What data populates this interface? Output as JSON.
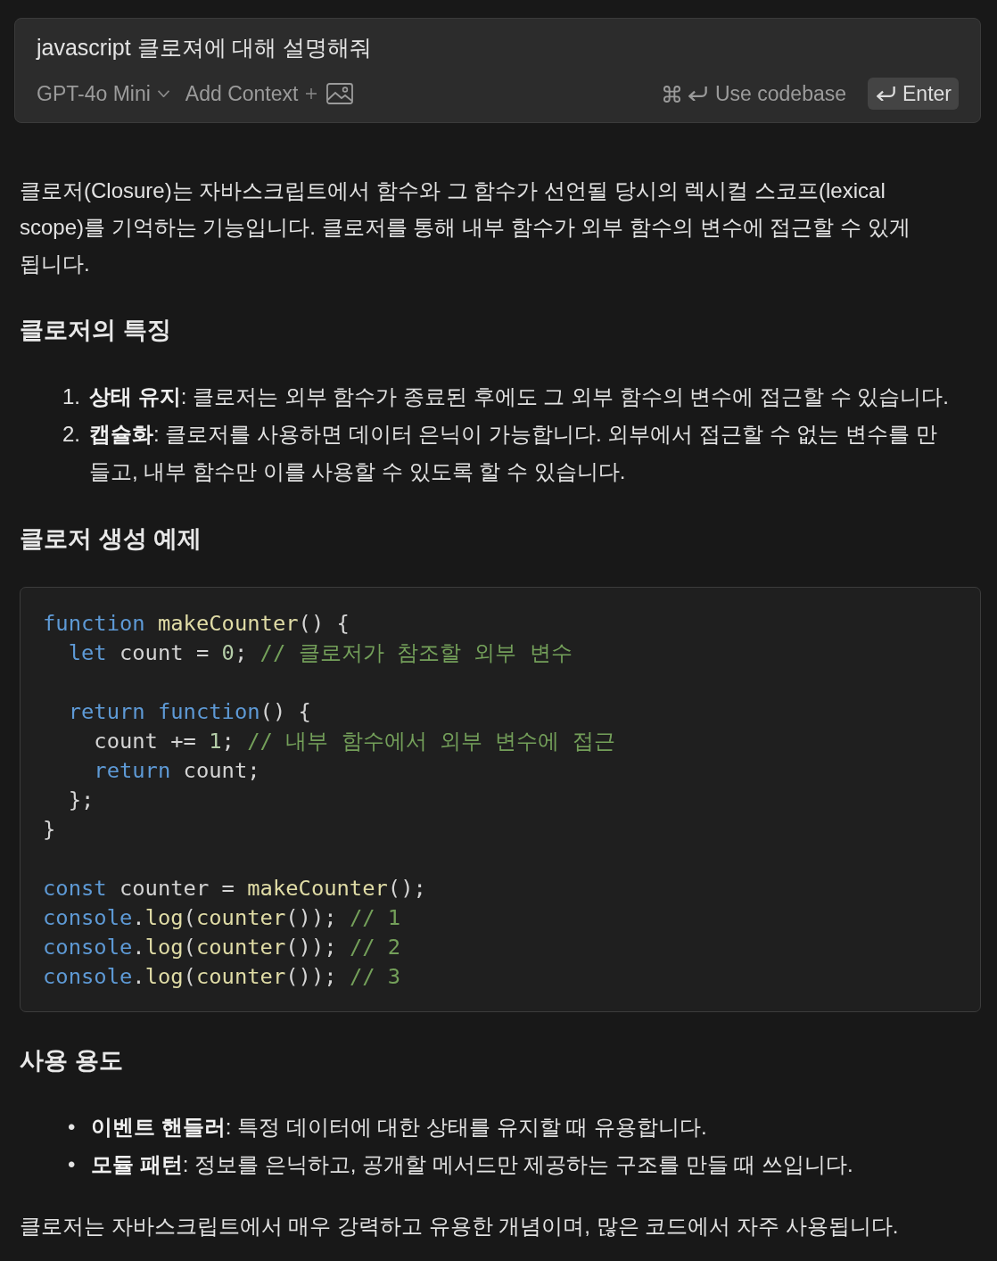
{
  "prompt": {
    "query": "javascript 클로져에 대해 설명해줘",
    "model": "GPT-4o Mini",
    "add_context": "Add Context",
    "use_codebase": "Use codebase",
    "enter": "Enter"
  },
  "answer": [
    {
      "kind": "paragraph",
      "text": "클로저(Closure)는 자바스크립트에서 함수와 그 함수가 선언될 당시의 렉시컬 스코프(lexical scope)를 기억하는 기능입니다. 클로저를 통해 내부 함수가 외부 함수의 변수에 접근할 수 있게 됩니다."
    },
    {
      "kind": "heading",
      "text": "클로저의 특징"
    },
    {
      "kind": "ordered_list",
      "items": [
        {
          "marker": "1.",
          "text": "**상태 유지**: 클로저는 외부 함수가 종료된 후에도 그 외부 함수의 변수에 접근할 수 있습니다."
        },
        {
          "marker": "2.",
          "text": "**캡슐화**: 클로저를 사용하면 데이터 은닉이 가능합니다. 외부에서 접근할 수 없는 변수를 만들고, 내부 함수만 이를 사용할 수 있도록 할 수 있습니다."
        }
      ]
    },
    {
      "kind": "heading",
      "text": "클로저 생성 예제"
    },
    {
      "kind": "code",
      "groups": [
        [
          [
            {
              "kind": "keyword",
              "text": "function "
            },
            {
              "kind": "function",
              "text": "makeCounter"
            },
            {
              "kind": "plain",
              "text": "() {"
            }
          ],
          [
            {
              "kind": "keyword",
              "text": "  let"
            },
            {
              "kind": "plain",
              "text": " count = "
            },
            {
              "kind": "number",
              "text": "0"
            },
            {
              "kind": "plain",
              "text": "; "
            },
            {
              "kind": "comment",
              "text": "// 클로저가 참조할 외부 변수"
            }
          ]
        ],
        [
          [
            {
              "kind": "keyword",
              "text": "  return function"
            },
            {
              "kind": "plain",
              "text": "() {"
            }
          ],
          [
            {
              "kind": "plain",
              "text": "    count += "
            },
            {
              "kind": "number",
              "text": "1"
            },
            {
              "kind": "plain",
              "text": "; "
            },
            {
              "kind": "comment",
              "text": "// 내부 함수에서 외부 변수에 접근"
            }
          ],
          [
            {
              "kind": "keyword",
              "text": "    return"
            },
            {
              "kind": "plain",
              "text": " count;"
            }
          ],
          [
            {
              "kind": "plain",
              "text": "  };"
            }
          ],
          [
            {
              "kind": "plain",
              "text": "}"
            }
          ]
        ],
        [
          [
            {
              "kind": "keyword",
              "text": "const"
            },
            {
              "kind": "plain",
              "text": " counter = "
            },
            {
              "kind": "function",
              "text": "makeCounter"
            },
            {
              "kind": "plain",
              "text": "();"
            }
          ],
          [
            {
              "kind": "keyword",
              "text": "console"
            },
            {
              "kind": "plain",
              "text": "."
            },
            {
              "kind": "function",
              "text": "log"
            },
            {
              "kind": "plain",
              "text": "("
            },
            {
              "kind": "function",
              "text": "counter"
            },
            {
              "kind": "plain",
              "text": "()); "
            },
            {
              "kind": "comment",
              "text": "// 1"
            }
          ],
          [
            {
              "kind": "keyword",
              "text": "console"
            },
            {
              "kind": "plain",
              "text": "."
            },
            {
              "kind": "function",
              "text": "log"
            },
            {
              "kind": "plain",
              "text": "("
            },
            {
              "kind": "function",
              "text": "counter"
            },
            {
              "kind": "plain",
              "text": "()); "
            },
            {
              "kind": "comment",
              "text": "// 2"
            }
          ],
          [
            {
              "kind": "keyword",
              "text": "console"
            },
            {
              "kind": "plain",
              "text": "."
            },
            {
              "kind": "function",
              "text": "log"
            },
            {
              "kind": "plain",
              "text": "("
            },
            {
              "kind": "function",
              "text": "counter"
            },
            {
              "kind": "plain",
              "text": "()); "
            },
            {
              "kind": "comment",
              "text": "// 3"
            }
          ]
        ]
      ]
    },
    {
      "kind": "heading",
      "text": "사용 용도"
    },
    {
      "kind": "bullet_list",
      "items": [
        {
          "marker": "•",
          "text": "**이벤트 핸들러**: 특정 데이터에 대한 상태를 유지할 때 유용합니다."
        },
        {
          "marker": "•",
          "text": "**모듈 패턴**: 정보를 은닉하고, 공개할 메서드만 제공하는 구조를 만들 때 쓰입니다."
        }
      ]
    },
    {
      "kind": "paragraph",
      "text": "클로저는 자바스크립트에서 매우 강력하고 유용한 개념이며, 많은 코드에서 자주 사용됩니다."
    }
  ]
}
